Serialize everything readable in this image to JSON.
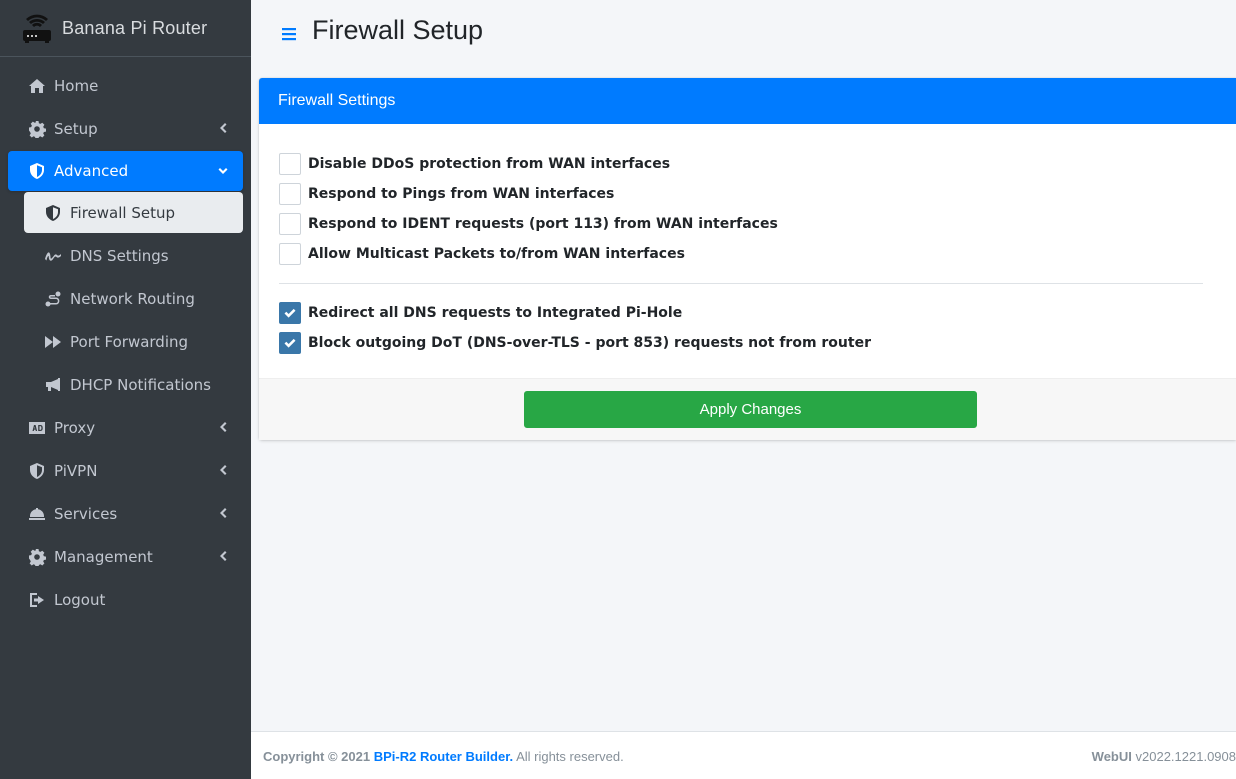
{
  "brand": {
    "title": "Banana Pi Router"
  },
  "sidebar": {
    "items": [
      {
        "label": "Home",
        "icon": "home-icon"
      },
      {
        "label": "Setup",
        "icon": "gear-icon"
      },
      {
        "label": "Advanced",
        "icon": "shield-icon"
      },
      {
        "label": "Firewall Setup",
        "icon": "shield-icon"
      },
      {
        "label": "DNS Settings",
        "icon": "signature-icon"
      },
      {
        "label": "Network Routing",
        "icon": "route-icon"
      },
      {
        "label": "Port Forwarding",
        "icon": "fast-forward-icon"
      },
      {
        "label": "DHCP Notifications",
        "icon": "bullhorn-icon"
      },
      {
        "label": "Proxy",
        "icon": "ad-icon"
      },
      {
        "label": "PiVPN",
        "icon": "shield-icon"
      },
      {
        "label": "Services",
        "icon": "concierge-bell-icon"
      },
      {
        "label": "Management",
        "icon": "gear-icon"
      },
      {
        "label": "Logout",
        "icon": "sign-out-icon"
      }
    ]
  },
  "header": {
    "title": "Firewall Setup"
  },
  "card": {
    "title": "Firewall Settings",
    "options": [
      {
        "label": "Disable DDoS protection from WAN interfaces",
        "checked": false
      },
      {
        "label": "Respond to Pings from WAN interfaces",
        "checked": false
      },
      {
        "label": "Respond to IDENT requests (port 113) from WAN interfaces",
        "checked": false
      },
      {
        "label": "Allow Multicast Packets to/from WAN interfaces",
        "checked": false
      },
      {
        "label": "Redirect all DNS requests to Integrated Pi-Hole",
        "checked": true
      },
      {
        "label": "Block outgoing DoT (DNS-over-TLS - port 853) requests not from router",
        "checked": true
      }
    ],
    "apply_label": "Apply Changes"
  },
  "footer": {
    "copyright": "Copyright © 2021",
    "link": "BPi-R2 Router Builder.",
    "rights": "All rights reserved.",
    "webui_label": "WebUI",
    "version": "v2022.1221.0908"
  },
  "colors": {
    "accent": "#007bff",
    "sidebar": "#343a40",
    "apply": "#28a745",
    "checkbox": "#3a77a9"
  }
}
